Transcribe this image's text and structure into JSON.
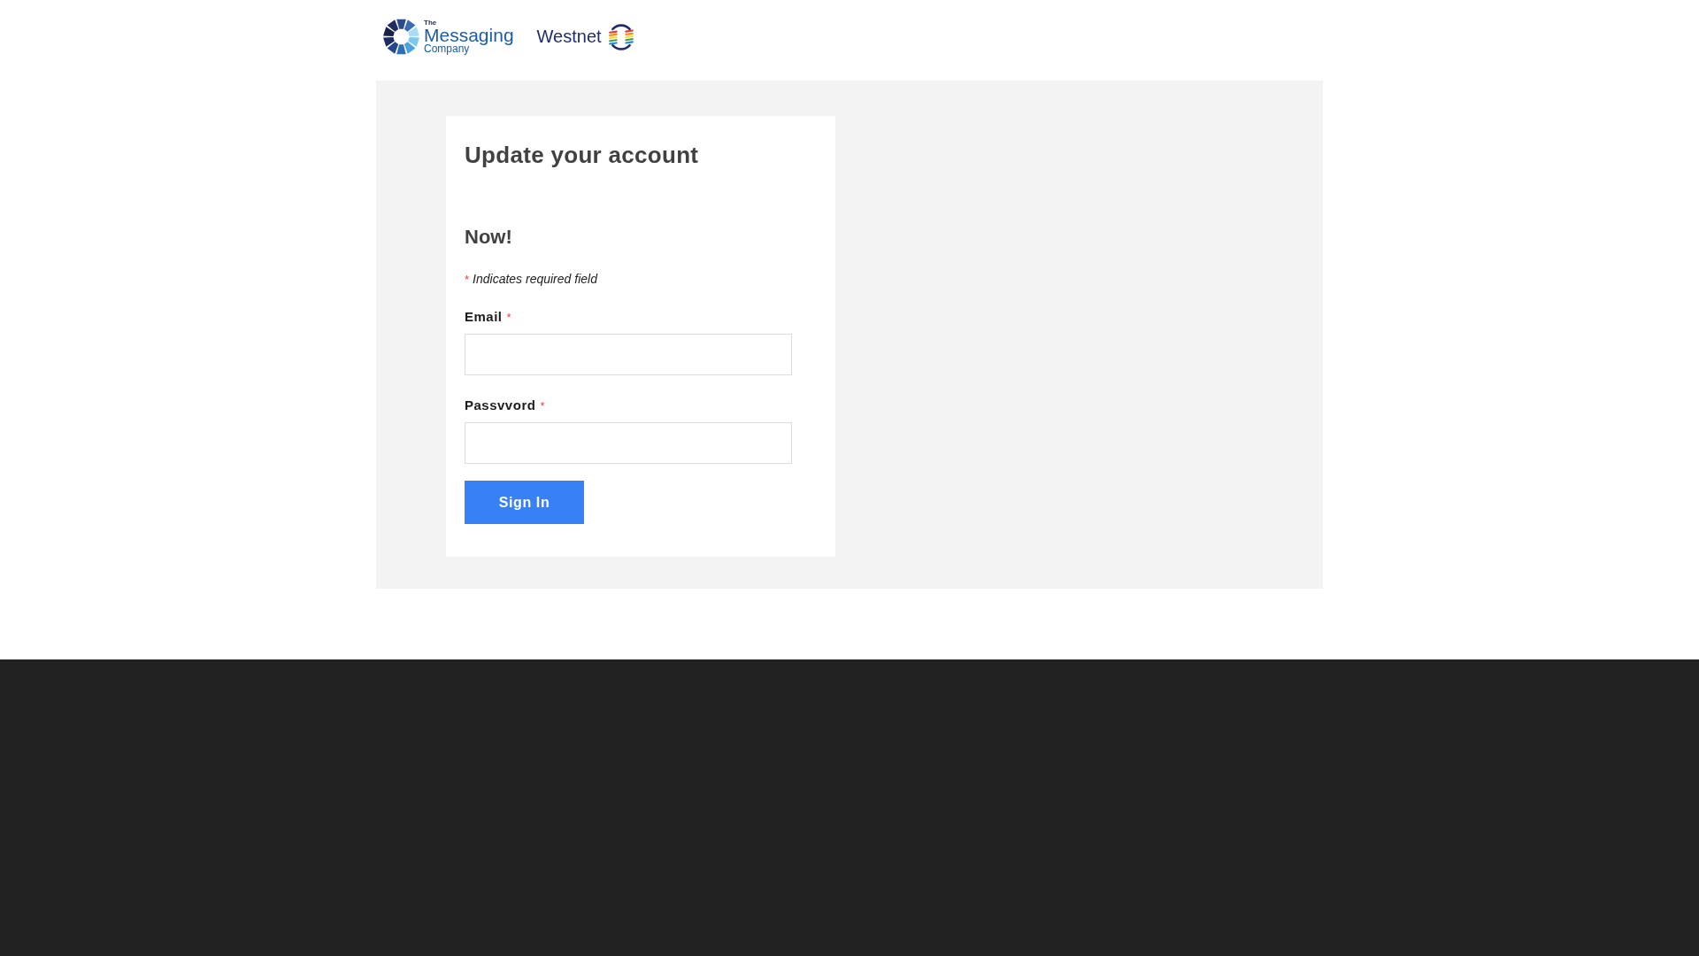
{
  "header": {
    "logos": [
      {
        "kind": "messaging",
        "lines": [
          "The",
          "Messaging",
          "Company"
        ]
      },
      {
        "kind": "westnet",
        "lines": [
          "Westnet"
        ]
      }
    ]
  },
  "form": {
    "title": "Update your account",
    "subtitle": "Now!",
    "required_note": {
      "mark": "*",
      "text": "Indicates required field"
    },
    "fields": [
      {
        "label": "Email",
        "mark": "*"
      },
      {
        "label": "Passvvord",
        "mark": "*"
      }
    ],
    "submit": "Sign In"
  }
}
